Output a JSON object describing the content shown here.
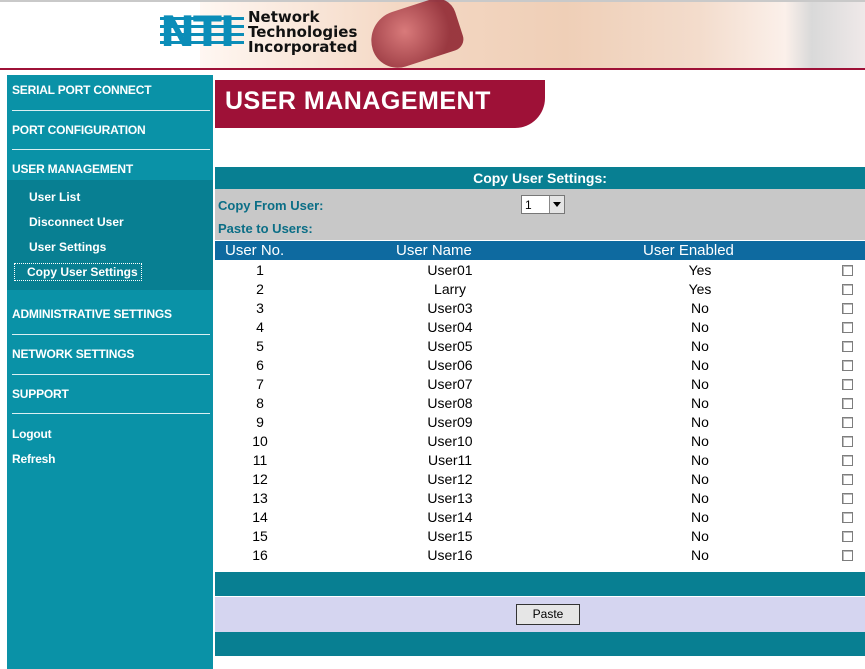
{
  "logo": {
    "mark": "NTI",
    "line1": "Network",
    "line2": "Technologies",
    "line3": "Incorporated"
  },
  "sidebar": {
    "items": [
      {
        "label": "SERIAL PORT CONNECT"
      },
      {
        "label": "PORT CONFIGURATION"
      },
      {
        "label": "USER MANAGEMENT"
      },
      {
        "label": "ADMINISTRATIVE SETTINGS"
      },
      {
        "label": "NETWORK SETTINGS"
      },
      {
        "label": "SUPPORT"
      },
      {
        "label": "Logout"
      },
      {
        "label": "Refresh"
      }
    ],
    "sub_items": [
      {
        "label": "User List"
      },
      {
        "label": "Disconnect User"
      },
      {
        "label": "User Settings"
      },
      {
        "label": "Copy User Settings"
      }
    ]
  },
  "page": {
    "title": "USER MANAGEMENT",
    "section_title": "Copy User Settings:",
    "copy_from_label": "Copy From User:",
    "copy_from_value": "1",
    "paste_to_label": "Paste to Users:",
    "paste_button": "Paste"
  },
  "table": {
    "headers": [
      "User No.",
      "User Name",
      "User Enabled"
    ],
    "rows": [
      {
        "no": "1",
        "name": "User01",
        "enabled": "Yes"
      },
      {
        "no": "2",
        "name": "Larry",
        "enabled": "Yes"
      },
      {
        "no": "3",
        "name": "User03",
        "enabled": "No"
      },
      {
        "no": "4",
        "name": "User04",
        "enabled": "No"
      },
      {
        "no": "5",
        "name": "User05",
        "enabled": "No"
      },
      {
        "no": "6",
        "name": "User06",
        "enabled": "No"
      },
      {
        "no": "7",
        "name": "User07",
        "enabled": "No"
      },
      {
        "no": "8",
        "name": "User08",
        "enabled": "No"
      },
      {
        "no": "9",
        "name": "User09",
        "enabled": "No"
      },
      {
        "no": "10",
        "name": "User10",
        "enabled": "No"
      },
      {
        "no": "11",
        "name": "User11",
        "enabled": "No"
      },
      {
        "no": "12",
        "name": "User12",
        "enabled": "No"
      },
      {
        "no": "13",
        "name": "User13",
        "enabled": "No"
      },
      {
        "no": "14",
        "name": "User14",
        "enabled": "No"
      },
      {
        "no": "15",
        "name": "User15",
        "enabled": "No"
      },
      {
        "no": "16",
        "name": "User16",
        "enabled": "No"
      }
    ]
  },
  "colors": {
    "teal": "#0a92a7",
    "dark_teal": "#087f92",
    "maroon": "#9e1137",
    "header_blue": "#0e6aa0",
    "lavender": "#d5d5f0",
    "gray": "#c8c8c8"
  }
}
